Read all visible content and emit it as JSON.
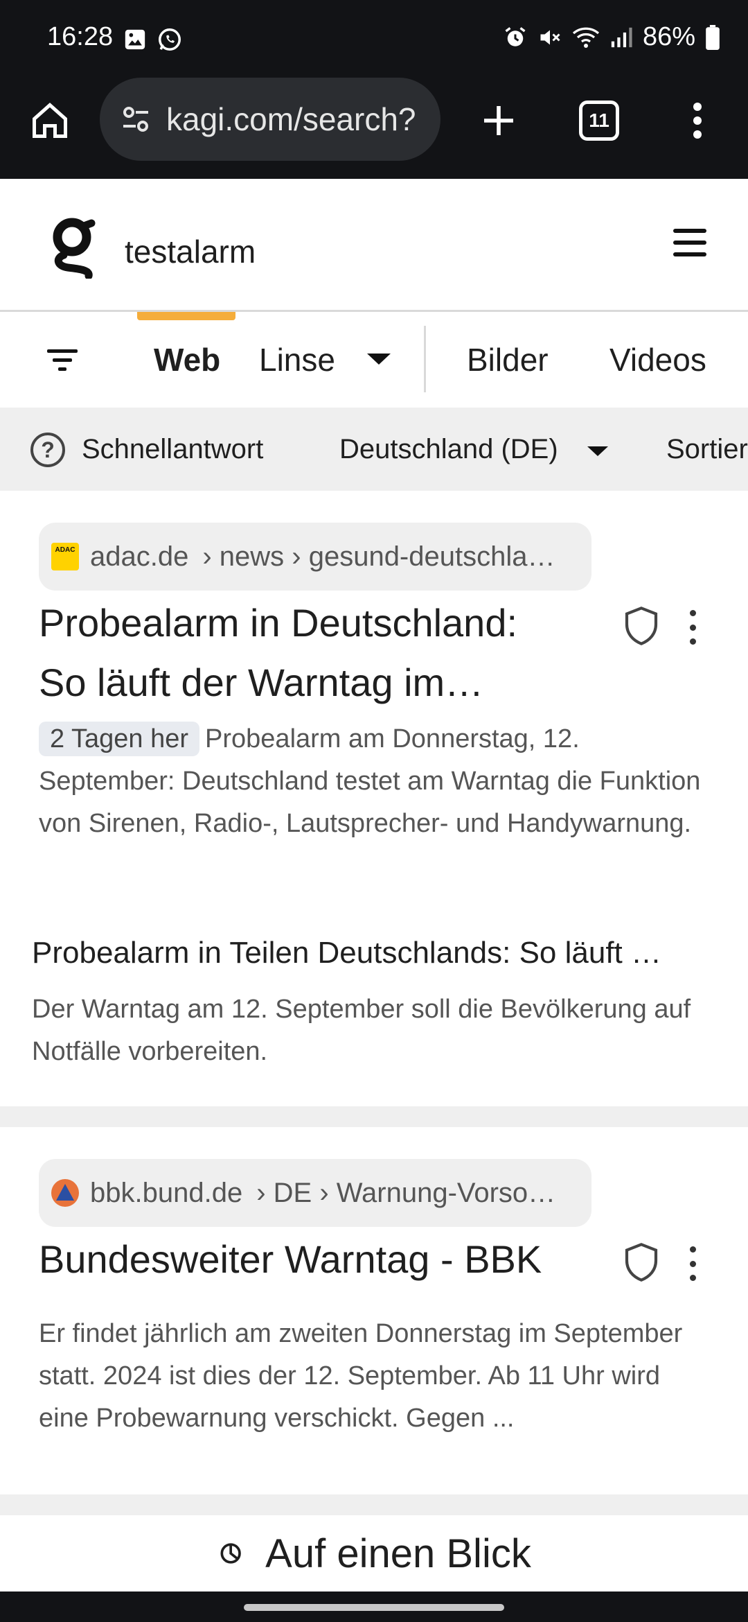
{
  "status_bar": {
    "time": "16:28",
    "battery": "86%",
    "icons": [
      "gallery-icon",
      "whatsapp-icon",
      "alarm-icon",
      "mute-icon",
      "wifi-icon",
      "signal-icon",
      "battery-icon"
    ]
  },
  "browser": {
    "url": "kagi.com/search?",
    "tab_count": "11"
  },
  "kagi": {
    "query": "testalarm"
  },
  "tabs": {
    "web": "Web",
    "linse": "Linse",
    "bilder": "Bilder",
    "videos": "Videos",
    "active": "Web",
    "accent_color": "#f5ad3b"
  },
  "filters": {
    "quick_answer": "Schnellantwort",
    "region": "Deutschland (DE)",
    "sort": "Sortier"
  },
  "results": [
    {
      "domain": "adac.de",
      "path": "› news › gesund-deutschla…",
      "title_line1": "Probealarm in Deutschland:",
      "title_line2": "So läuft der Warntag im…",
      "date": "2 Tagen her",
      "snippet": "Probealarm am Donnerstag, 12. September: Deutschland testet am Warntag die Funktion von Sirenen, Radio-, Lautsprecher- und Handywarnung.",
      "sub_title": "Probealarm in Teilen Deutschlands: So läuft …",
      "sub_snippet": "Der Warntag am 12. September soll die Bevölkerung auf Notfälle vorbereiten."
    },
    {
      "domain": "bbk.bund.de",
      "path": "› DE › Warnung-Vorso…",
      "title": "Bundesweiter Warntag - BBK",
      "snippet": "Er findet jährlich am zweiten Donnerstag im September statt. 2024 ist dies der 12. September. Ab 11 Uhr wird eine Probewarnung verschickt. Gegen ..."
    }
  ],
  "at_a_glance": "Auf einen Blick"
}
